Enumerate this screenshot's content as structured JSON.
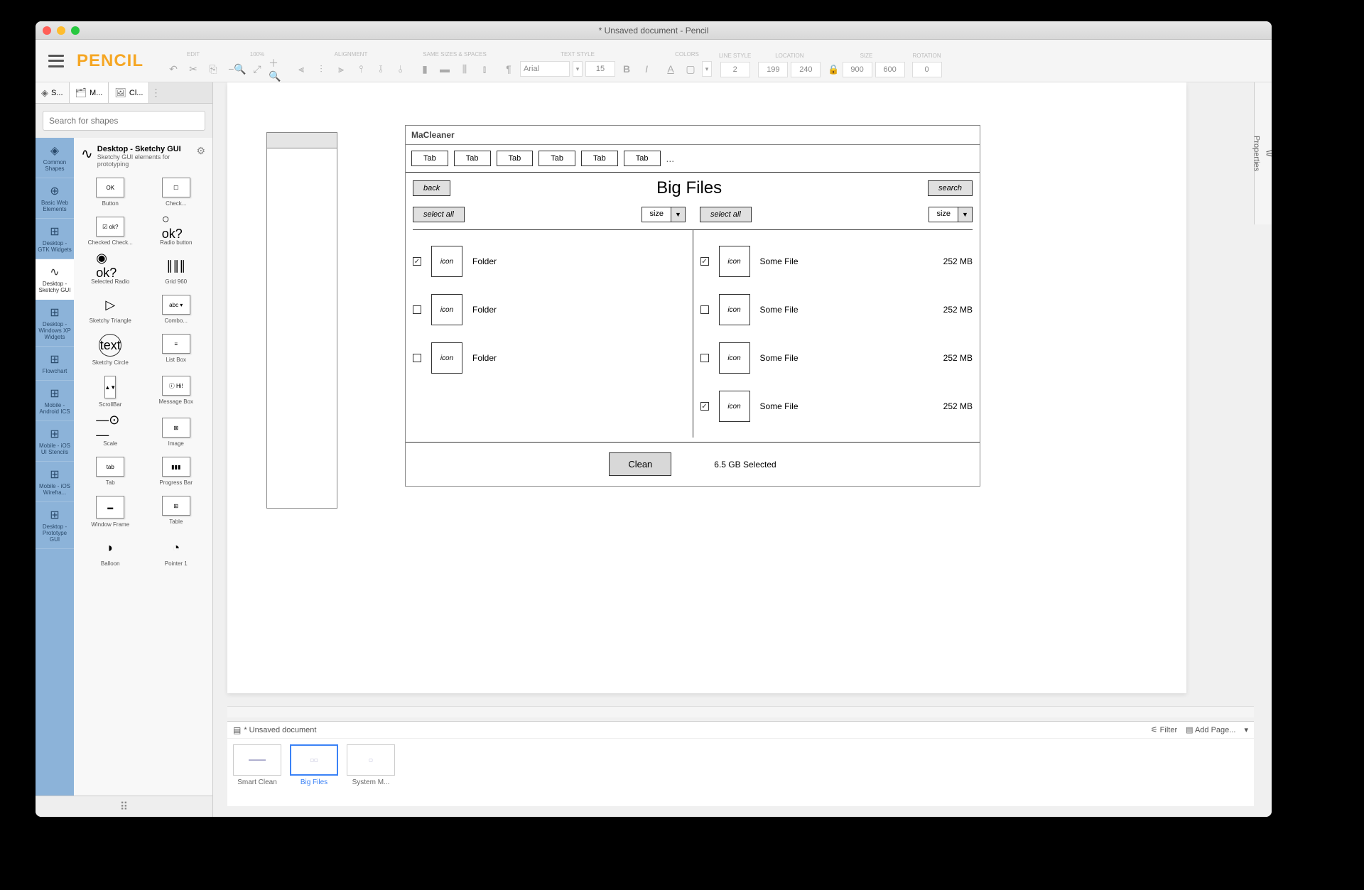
{
  "window": {
    "title": "* Unsaved document - Pencil"
  },
  "logo": "PENCIL",
  "toolbarGroups": {
    "edit": "EDIT",
    "zoom": "100%",
    "alignment": "ALIGNMENT",
    "sameSizes": "SAME SIZES & SPACES",
    "textStyle": "TEXT STYLE",
    "colors": "COLORS",
    "lineStyle": "LINE STYLE",
    "location": "LOCATION",
    "size": "SIZE",
    "rotation": "ROTATION",
    "font": "Arial",
    "fontSize": "15",
    "lineWidth": "2",
    "locX": "199",
    "locY": "240",
    "sizeW": "900",
    "sizeH": "600",
    "rot": "0"
  },
  "panelTabs": {
    "t1": "S...",
    "t2": "M...",
    "t3": "Cl..."
  },
  "shapeSearchPlaceholder": "Search for shapes",
  "categories": {
    "c0": "Common Shapes",
    "c1": "Basic Web Elements",
    "c2": "Desktop - GTK Widgets",
    "c3": "Desktop - Sketchy GUI",
    "c4": "Desktop - Windows XP Widgets",
    "c5": "Flowchart",
    "c6": "Mobile - Android ICS",
    "c7": "Mobile - iOS UI Stencils",
    "c8": "Mobile - iOS Wirefra...",
    "c9": "Desktop - Prototype GUI"
  },
  "collection": {
    "name": "Desktop - Sketchy GUI",
    "desc": "Sketchy GUI elements for prototyping"
  },
  "shapes": {
    "s0": "Button",
    "s1": "Check...",
    "s2": "Checked Check...",
    "s3": "Radio button",
    "s4": "Selected Radio",
    "s5": "Grid 960",
    "s6": "Sketchy Triangle",
    "s7": "Combo...",
    "s8": "Sketchy Circle",
    "s9": "List Box",
    "s10": "ScrollBar",
    "s11": "Message Box",
    "s12": "Scale",
    "s13": "Image",
    "s14": "Tab",
    "s15": "Progress Bar",
    "s16": "Window Frame",
    "s17": "Table",
    "s18": "Balloon",
    "s19": "Pointer 1"
  },
  "shapeThumbs": {
    "t0": "OK",
    "t2": "☑ ok?",
    "t3": "○ ok?",
    "t4": "◉ ok?",
    "t7": "abc ▾",
    "t8": "text",
    "t11": "ⓘ Hi!",
    "t13": "⊠",
    "t14": "tab"
  },
  "mockup": {
    "appTitle": "MaCleaner",
    "tab": "Tab",
    "ellipsis": "...",
    "back": "back",
    "search": "search",
    "pageTitle": "Big Files",
    "selectAll": "select all",
    "size": "size",
    "arrow": "▼",
    "iconLabel": "icon",
    "folders": {
      "f0": "Folder",
      "f1": "Folder",
      "f2": "Folder"
    },
    "folderChecks": {
      "f0": true,
      "f1": false,
      "f2": false
    },
    "files": {
      "f0": {
        "name": "Some File",
        "size": "252 MB",
        "checked": true
      },
      "f1": {
        "name": "Some File",
        "size": "252 MB",
        "checked": false
      },
      "f2": {
        "name": "Some File",
        "size": "252 MB",
        "checked": false
      },
      "f3": {
        "name": "Some File",
        "size": "252 MB",
        "checked": true
      }
    },
    "clean": "Clean",
    "selected": "6.5 GB Selected"
  },
  "pagesBar": {
    "doc": "* Unsaved document",
    "filter": "Filter",
    "addPage": "Add Page...",
    "p0": "Smart Clean",
    "p1": "Big Files",
    "p2": "System M..."
  },
  "rightPanel": "Properties"
}
